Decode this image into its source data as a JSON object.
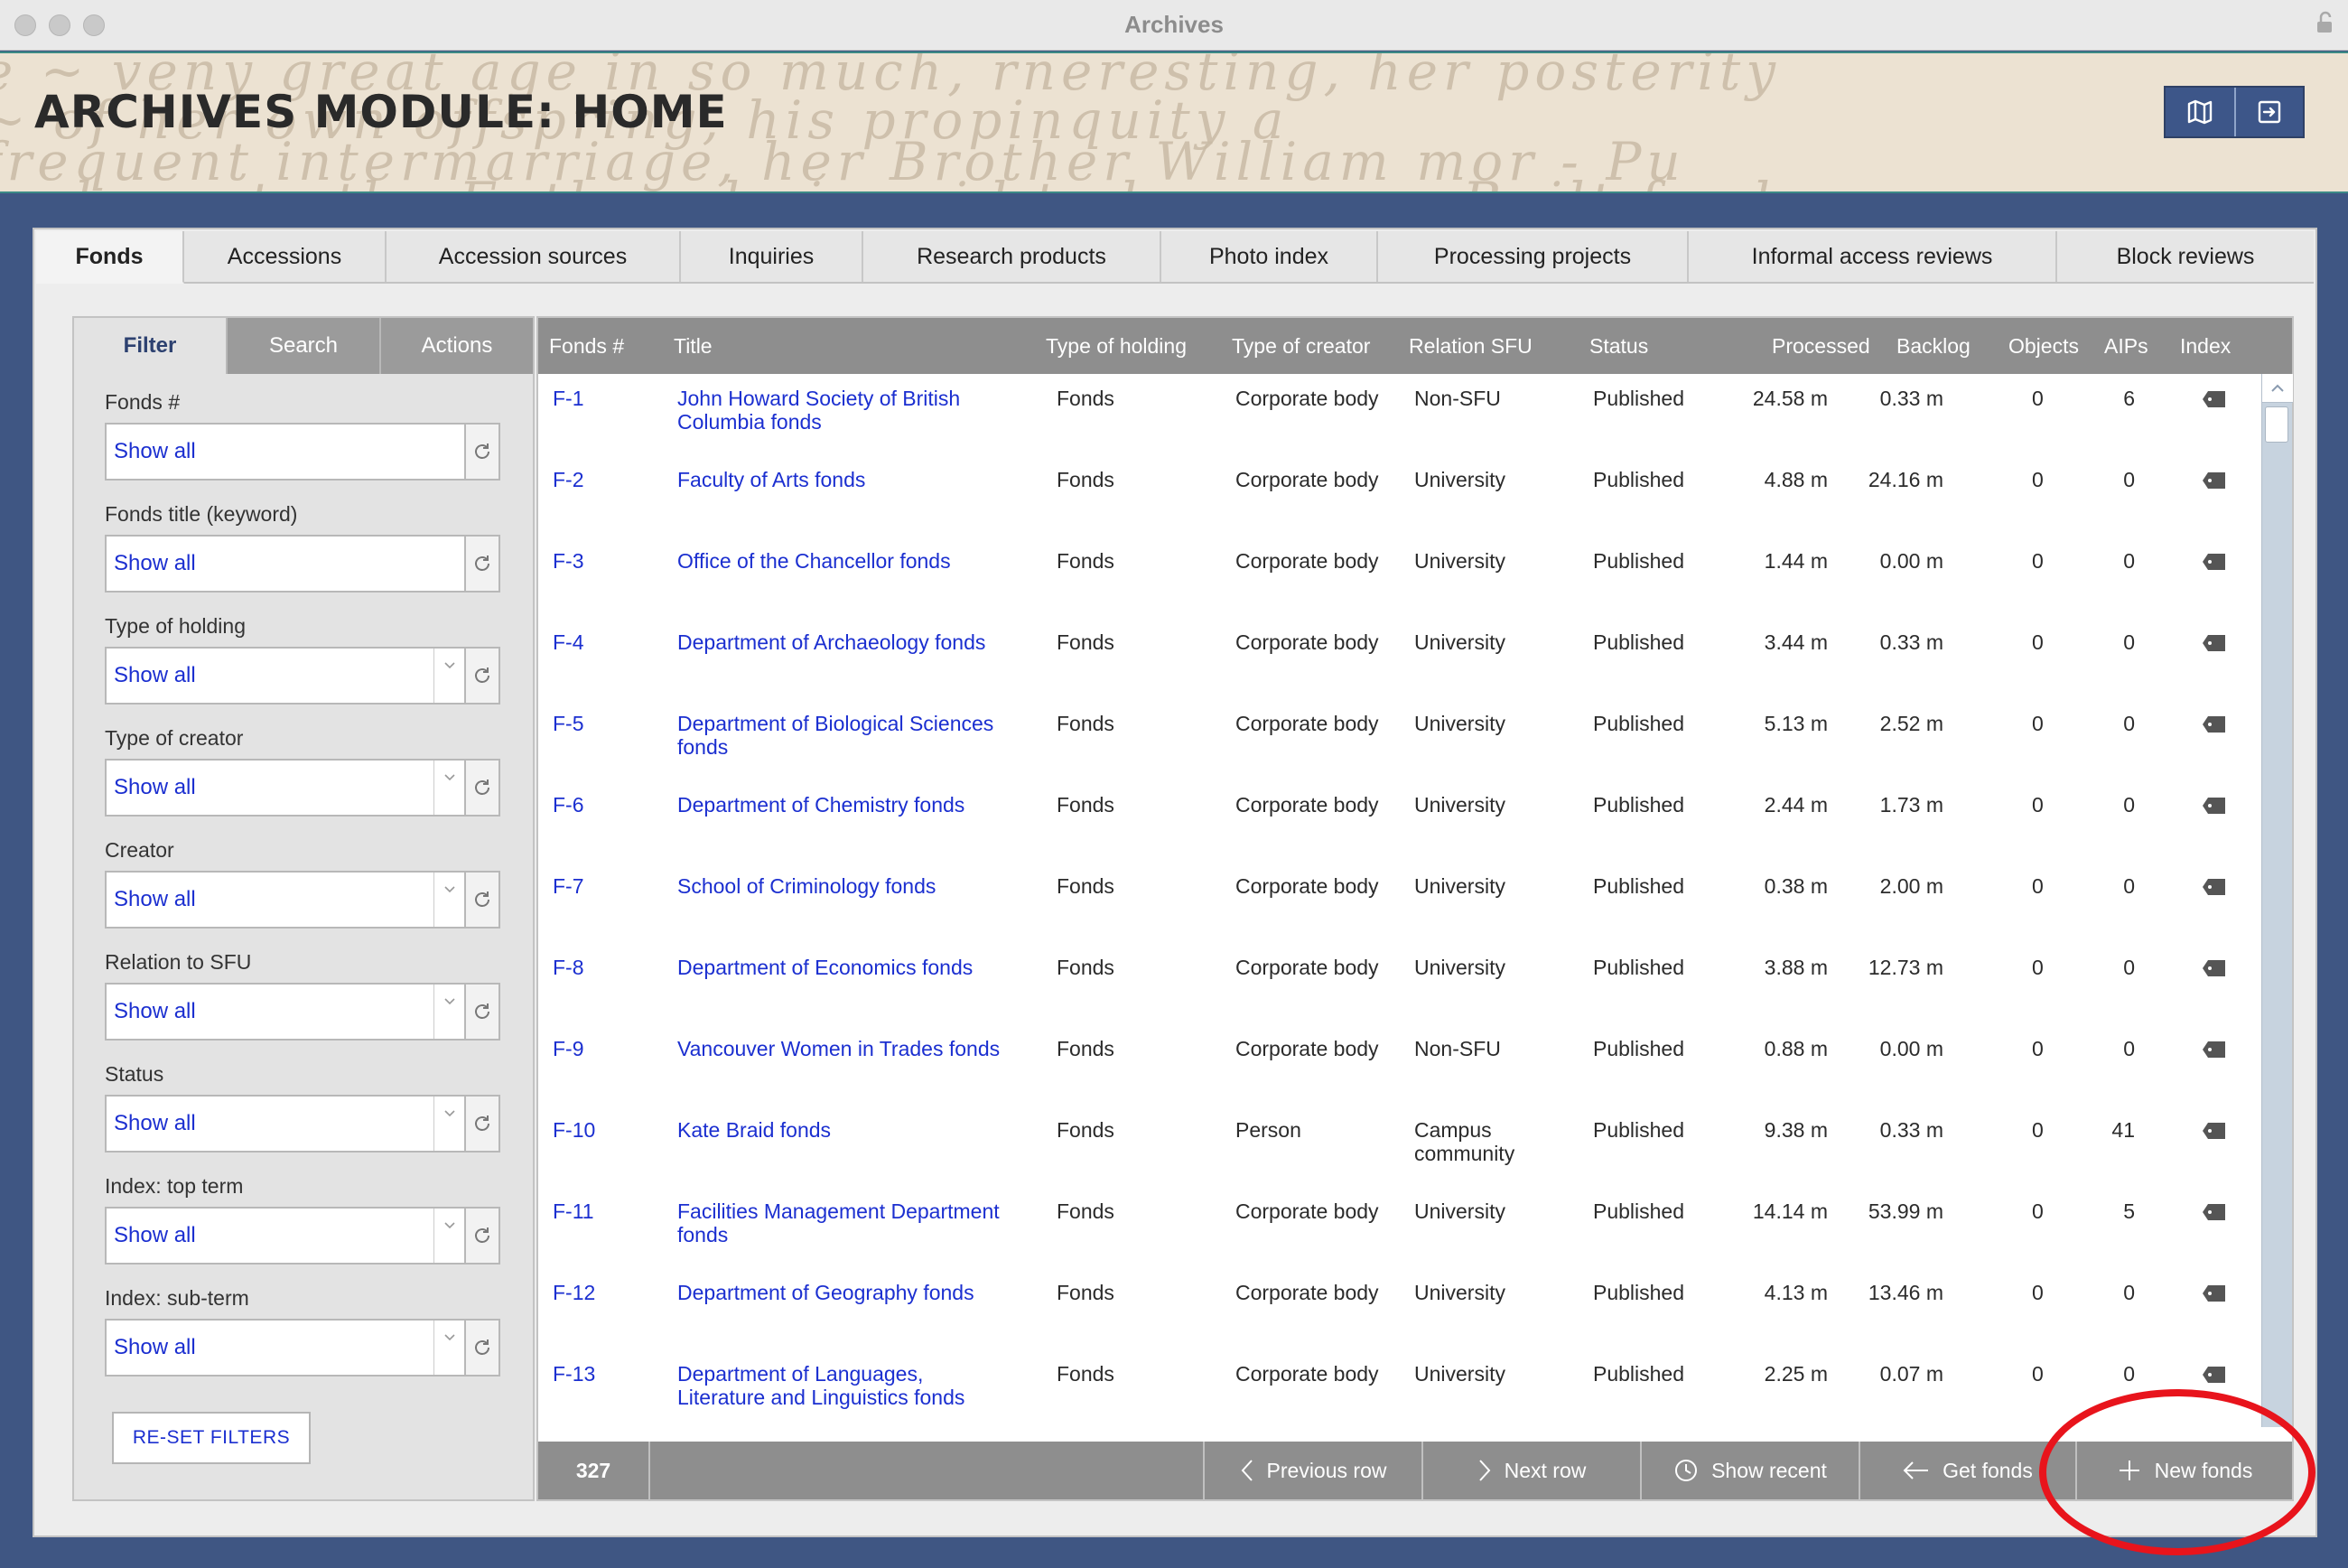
{
  "window": {
    "title": "Archives"
  },
  "header": {
    "title": "ARCHIVES MODULE: HOME"
  },
  "tabs": [
    "Fonds",
    "Accessions",
    "Accession sources",
    "Inquiries",
    "Research products",
    "Photo index",
    "Processing projects",
    "Informal access reviews",
    "Block reviews"
  ],
  "side_tabs": [
    "Filter",
    "Search",
    "Actions"
  ],
  "filters": [
    {
      "label": "Fonds #",
      "value": "Show all",
      "dropdown": false
    },
    {
      "label": "Fonds title (keyword)",
      "value": "Show all",
      "dropdown": false
    },
    {
      "label": "Type of holding",
      "value": "Show all",
      "dropdown": true
    },
    {
      "label": "Type of creator",
      "value": "Show all",
      "dropdown": true
    },
    {
      "label": "Creator",
      "value": "Show all",
      "dropdown": true
    },
    {
      "label": "Relation to SFU",
      "value": "Show all",
      "dropdown": true
    },
    {
      "label": "Status",
      "value": "Show all",
      "dropdown": true
    },
    {
      "label": "Index: top term",
      "value": "Show all",
      "dropdown": true
    },
    {
      "label": "Index: sub-term",
      "value": "Show all",
      "dropdown": true
    }
  ],
  "reset_label": "RE-SET FILTERS",
  "table": {
    "columns": [
      "Fonds #",
      "Title",
      "Type of holding",
      "Type of creator",
      "Relation SFU",
      "Status",
      "Processed",
      "Backlog",
      "Objects",
      "AIPs",
      "Index"
    ],
    "rows": [
      {
        "id": "F-1",
        "title": [
          "John Howard Society of British",
          "Columbia fonds"
        ],
        "holding": "Fonds",
        "creator": "Corporate body",
        "relation": [
          "Non-SFU"
        ],
        "status": "Published",
        "processed": "24.58 m",
        "backlog": "0.33 m",
        "objects": "0",
        "aips": "6"
      },
      {
        "id": "F-2",
        "title": [
          "Faculty of Arts fonds"
        ],
        "holding": "Fonds",
        "creator": "Corporate body",
        "relation": [
          "University"
        ],
        "status": "Published",
        "processed": "4.88 m",
        "backlog": "24.16 m",
        "objects": "0",
        "aips": "0"
      },
      {
        "id": "F-3",
        "title": [
          "Office of the Chancellor fonds"
        ],
        "holding": "Fonds",
        "creator": "Corporate body",
        "relation": [
          "University"
        ],
        "status": "Published",
        "processed": "1.44 m",
        "backlog": "0.00 m",
        "objects": "0",
        "aips": "0"
      },
      {
        "id": "F-4",
        "title": [
          "Department of Archaeology fonds"
        ],
        "holding": "Fonds",
        "creator": "Corporate body",
        "relation": [
          "University"
        ],
        "status": "Published",
        "processed": "3.44 m",
        "backlog": "0.33 m",
        "objects": "0",
        "aips": "0"
      },
      {
        "id": "F-5",
        "title": [
          "Department of Biological Sciences",
          "fonds"
        ],
        "holding": "Fonds",
        "creator": "Corporate body",
        "relation": [
          "University"
        ],
        "status": "Published",
        "processed": "5.13 m",
        "backlog": "2.52 m",
        "objects": "0",
        "aips": "0"
      },
      {
        "id": "F-6",
        "title": [
          "Department of Chemistry fonds"
        ],
        "holding": "Fonds",
        "creator": "Corporate body",
        "relation": [
          "University"
        ],
        "status": "Published",
        "processed": "2.44 m",
        "backlog": "1.73 m",
        "objects": "0",
        "aips": "0"
      },
      {
        "id": "F-7",
        "title": [
          "School of Criminology fonds"
        ],
        "holding": "Fonds",
        "creator": "Corporate body",
        "relation": [
          "University"
        ],
        "status": "Published",
        "processed": "0.38 m",
        "backlog": "2.00 m",
        "objects": "0",
        "aips": "0"
      },
      {
        "id": "F-8",
        "title": [
          "Department of Economics fonds"
        ],
        "holding": "Fonds",
        "creator": "Corporate body",
        "relation": [
          "University"
        ],
        "status": "Published",
        "processed": "3.88 m",
        "backlog": "12.73 m",
        "objects": "0",
        "aips": "0"
      },
      {
        "id": "F-9",
        "title": [
          "Vancouver Women in Trades fonds"
        ],
        "holding": "Fonds",
        "creator": "Corporate body",
        "relation": [
          "Non-SFU"
        ],
        "status": "Published",
        "processed": "0.88 m",
        "backlog": "0.00 m",
        "objects": "0",
        "aips": "0"
      },
      {
        "id": "F-10",
        "title": [
          "Kate Braid fonds"
        ],
        "holding": "Fonds",
        "creator": "Person",
        "relation": [
          "Campus",
          "community"
        ],
        "status": "Published",
        "processed": "9.38 m",
        "backlog": "0.33 m",
        "objects": "0",
        "aips": "41"
      },
      {
        "id": "F-11",
        "title": [
          "Facilities Management Department",
          "fonds"
        ],
        "holding": "Fonds",
        "creator": "Corporate body",
        "relation": [
          "University"
        ],
        "status": "Published",
        "processed": "14.14 m",
        "backlog": "53.99 m",
        "objects": "0",
        "aips": "5"
      },
      {
        "id": "F-12",
        "title": [
          "Department of Geography fonds"
        ],
        "holding": "Fonds",
        "creator": "Corporate body",
        "relation": [
          "University"
        ],
        "status": "Published",
        "processed": "4.13 m",
        "backlog": "13.46 m",
        "objects": "0",
        "aips": "0"
      },
      {
        "id": "F-13",
        "title": [
          "Department of Languages,",
          "Literature and Linguistics fonds"
        ],
        "holding": "Fonds",
        "creator": "Corporate body",
        "relation": [
          "University"
        ],
        "status": "Published",
        "processed": "2.25 m",
        "backlog": "0.07 m",
        "objects": "0",
        "aips": "0"
      }
    ]
  },
  "footer": {
    "count": "327",
    "buttons": [
      {
        "label": "Previous row",
        "icon": "chevron-left-icon"
      },
      {
        "label": "Next row",
        "icon": "chevron-right-icon"
      },
      {
        "label": "Show recent",
        "icon": "clock-icon"
      },
      {
        "label": "Get fonds",
        "icon": "arrow-left-icon"
      },
      {
        "label": "New fonds",
        "icon": "plus-icon"
      }
    ]
  },
  "colors": {
    "accent": "#3d5689",
    "link": "#1b2fd0",
    "highlight": "#e8141c"
  }
}
